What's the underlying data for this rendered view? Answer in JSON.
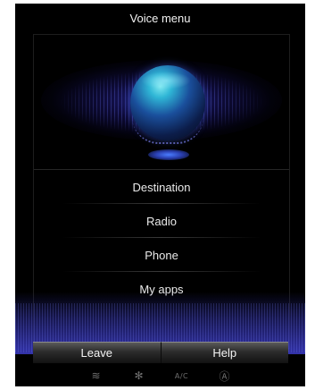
{
  "header": {
    "title": "Voice menu"
  },
  "menu": {
    "items": [
      {
        "label": "Destination"
      },
      {
        "label": "Radio"
      },
      {
        "label": "Phone"
      },
      {
        "label": "My apps"
      }
    ]
  },
  "buttons": {
    "leave_label": "Leave",
    "help_label": "Help"
  },
  "climate": {
    "heat_icon_glyph": "≋",
    "fan_icon_glyph": "✻",
    "ac_label": "A/C",
    "auto_icon_glyph": "Ⓐ"
  },
  "colors": {
    "accent": "#2a4cff",
    "orb": "#2fb6d6"
  }
}
